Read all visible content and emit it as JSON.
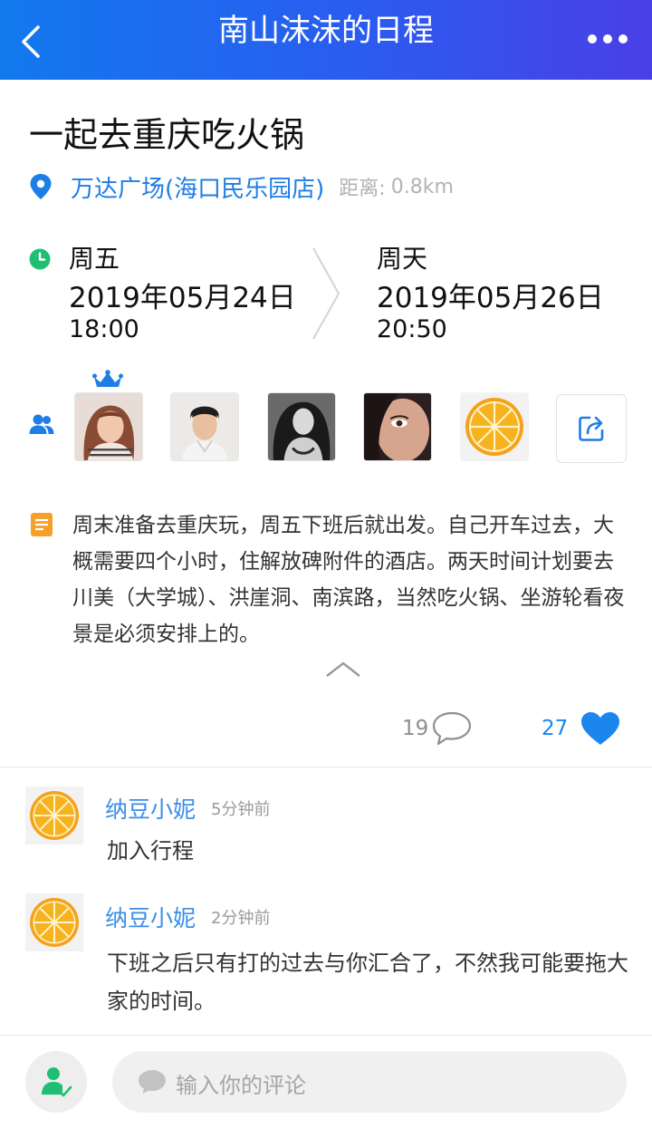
{
  "header": {
    "title": "南山沫沫的日程",
    "back_icon": "chevron-left-icon",
    "more_icon": "more-dots-icon"
  },
  "event": {
    "title": "一起去重庆吃火锅",
    "location": {
      "name": "万达广场(海口民乐园店)",
      "distance_label": "距离:",
      "distance_value": "0.8km",
      "icon": "location-pin-icon",
      "color": "#1f7de6"
    },
    "start": {
      "day": "周五",
      "date": "2019年05月24日",
      "time": "18:00"
    },
    "end": {
      "day": "周天",
      "date": "2019年05月26日",
      "time": "20:50"
    }
  },
  "participants": {
    "icon": "people-icon",
    "owner_badge": "crown-icon",
    "avatars": [
      "avatar-woman-1",
      "avatar-man",
      "avatar-woman-2",
      "avatar-woman-3",
      "avatar-orange"
    ],
    "share_icon": "share-icon"
  },
  "description": {
    "icon": "note-icon",
    "text": "周末准备去重庆玩，周五下班后就出发。自己开车过去，大概需要四个小时，住解放碑附件的酒店。两天时间计划要去川美（大学城）、洪崖洞、南滨路，当然吃火锅、坐游轮看夜景是必须安排上的。"
  },
  "stats": {
    "comments": "19",
    "likes": "27",
    "like_color": "#1a86ee"
  },
  "comments": [
    {
      "name": "纳豆小妮",
      "time": "5分钟前",
      "text": "加入行程"
    },
    {
      "name": "纳豆小妮",
      "time": "2分钟前",
      "text": "下班之后只有打的过去与你汇合了，不然我可能要拖大家的时间。"
    }
  ],
  "footer": {
    "input_placeholder": "输入你的评论",
    "join_icon": "user-check-icon"
  }
}
